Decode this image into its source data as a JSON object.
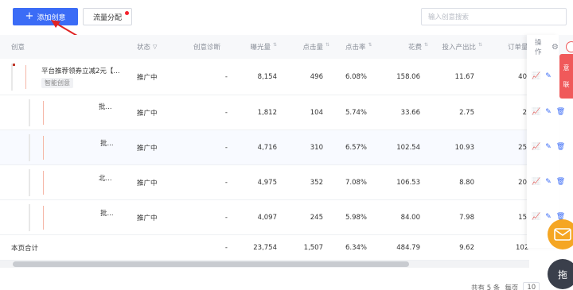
{
  "toolbar": {
    "add_label": "添加创意",
    "flow_label": "流量分配",
    "search_placeholder": "输入创意搜索"
  },
  "header": {
    "creative": "创意",
    "status": "状态",
    "diagnosis": "创意诊断",
    "impressions": "曝光量",
    "clicks": "点击量",
    "ctr": "点击率",
    "cost": "花费",
    "roi": "投入产出比",
    "orders": "订单量",
    "actions": "操作"
  },
  "rows": [
    {
      "title": "平台推荐领券立减2元【...",
      "tag": "智能创意",
      "status": "推广中",
      "diagnosis": "-",
      "impressions": "8,154",
      "clicks": "496",
      "ctr": "6.08%",
      "cost": "158.06",
      "roi": "11.67",
      "orders": "40"
    },
    {
      "title": "批...",
      "tag": "",
      "status": "推广中",
      "diagnosis": "-",
      "impressions": "1,812",
      "clicks": "104",
      "ctr": "5.74%",
      "cost": "33.66",
      "roi": "2.75",
      "orders": "2"
    },
    {
      "title": "批...",
      "tag": "",
      "status": "推广中",
      "diagnosis": "-",
      "impressions": "4,716",
      "clicks": "310",
      "ctr": "6.57%",
      "cost": "102.54",
      "roi": "10.93",
      "orders": "25"
    },
    {
      "title": "北...",
      "tag": "",
      "status": "推广中",
      "diagnosis": "-",
      "impressions": "4,975",
      "clicks": "352",
      "ctr": "7.08%",
      "cost": "106.53",
      "roi": "8.80",
      "orders": "20"
    },
    {
      "title": "批...",
      "tag": "",
      "status": "推广中",
      "diagnosis": "-",
      "impressions": "4,097",
      "clicks": "245",
      "ctr": "5.98%",
      "cost": "84.00",
      "roi": "7.98",
      "orders": "15"
    }
  ],
  "total": {
    "label": "本页合计",
    "diagnosis": "-",
    "impressions": "23,754",
    "clicks": "1,507",
    "ctr": "6.34%",
    "cost": "484.79",
    "roi": "9.62",
    "orders": "102"
  },
  "side": {
    "text1": "意",
    "text2": "联"
  },
  "pager": {
    "summary": "共有 5 条",
    "per_page_label": "每页",
    "per_page_value": "10"
  },
  "float_btn_label": "拖"
}
